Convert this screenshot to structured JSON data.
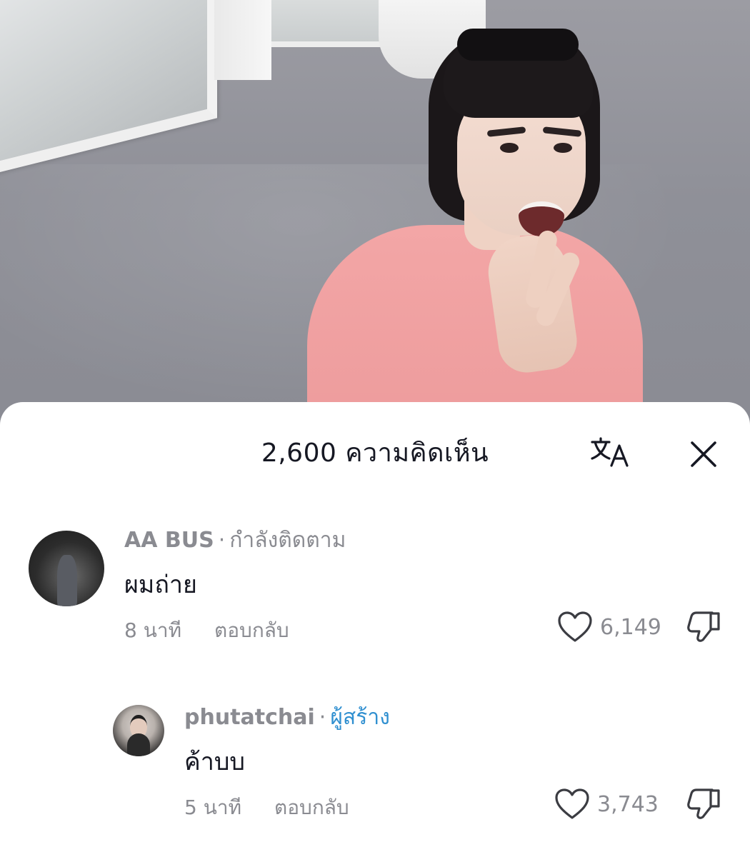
{
  "sheet": {
    "title": "2,600 ความคิดเห็น",
    "translate_icon": "translate-icon",
    "close_icon": "close-icon"
  },
  "comments": [
    {
      "username": "AA BUS",
      "separator": "·",
      "tag": "กำลังติดตาม",
      "text": "ผมถ่าย",
      "time": "8 นาที",
      "reply_label": "ตอบกลับ",
      "likes": "6,149"
    },
    {
      "username": "phutatchai",
      "separator": "·",
      "tag": "ผู้สร้าง",
      "text": "ค้าบบ",
      "time": "5 นาที",
      "reply_label": "ตอบกลับ",
      "likes": "3,743"
    }
  ],
  "colors": {
    "creator_tag": "#2f8fd0",
    "secondary_text": "#8a8b91",
    "primary_text": "#161823"
  }
}
